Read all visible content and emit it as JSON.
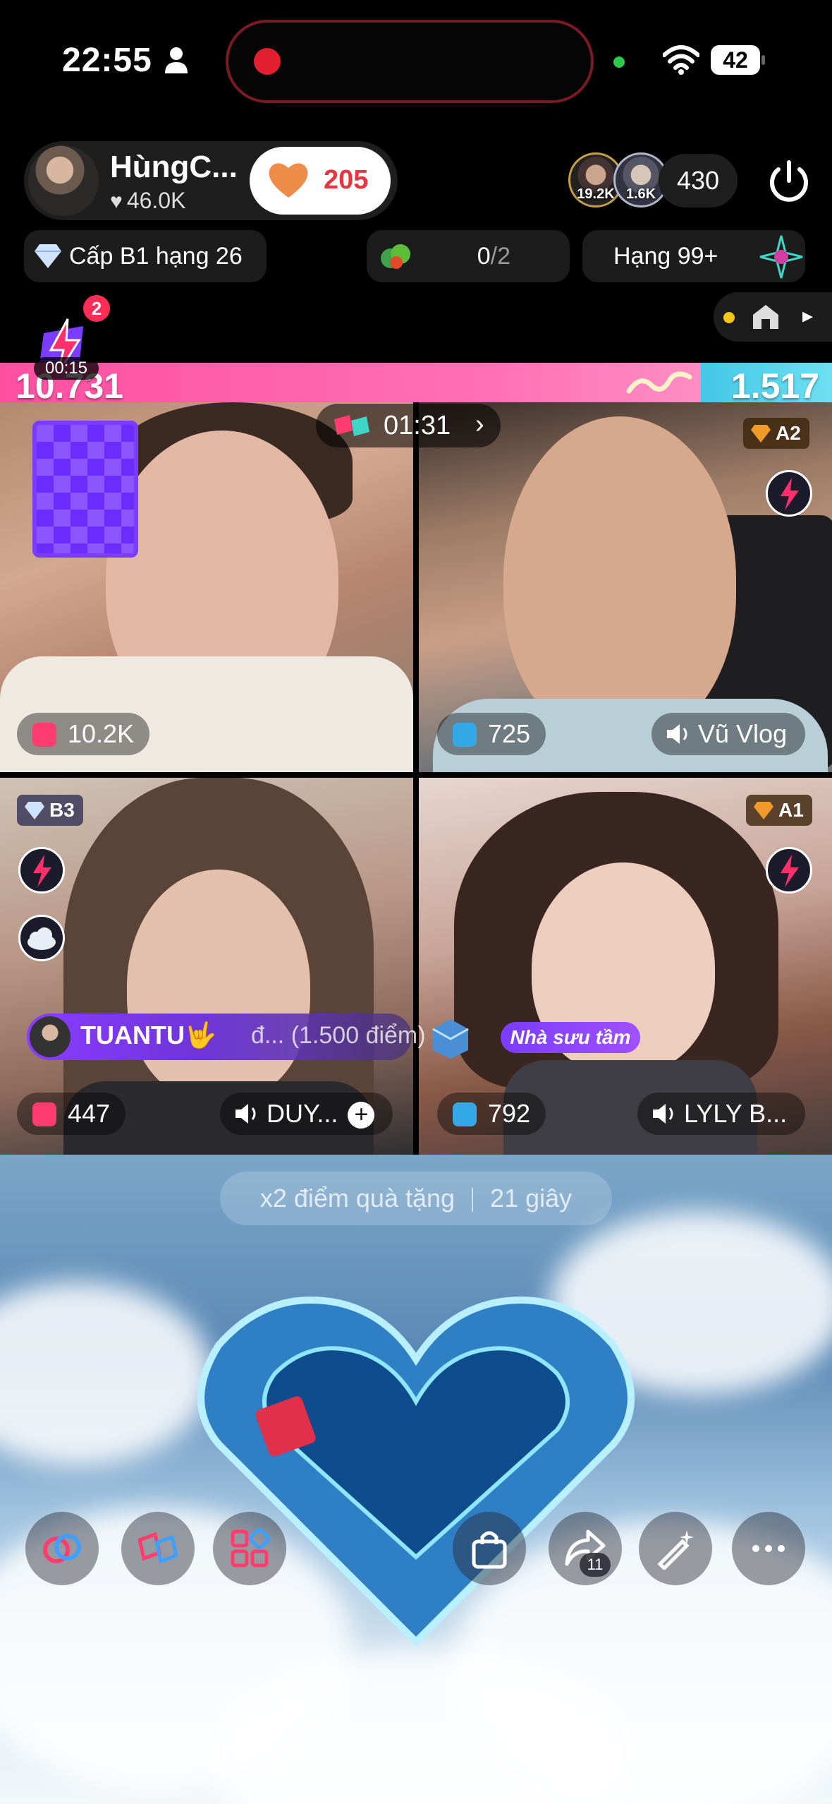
{
  "status_bar": {
    "time": "22:55",
    "battery": "42"
  },
  "host": {
    "name": "HùngC...",
    "likes": "46.0K",
    "follow_count": "205"
  },
  "viewers": {
    "avatar1_count": "19.2K",
    "avatar2_count": "1.6K",
    "total": "430"
  },
  "badges": {
    "level": "Cấp B1 hạng 26",
    "goal_num": "0",
    "goal_den": "/2",
    "rank": "Hạng 99+"
  },
  "gift": {
    "badge_count": "2",
    "timer": "00:15"
  },
  "battle": {
    "score_left": "10.731",
    "score_right": "1.517",
    "timer": "01:31"
  },
  "tiles": [
    {
      "score": "10.2K",
      "level": "",
      "name": ""
    },
    {
      "score": "725",
      "level": "A2",
      "name": "Vũ Vlog"
    },
    {
      "score": "447",
      "level": "B3",
      "name": "DUY..."
    },
    {
      "score": "792",
      "level": "A1",
      "name": "LYLY B..."
    }
  ],
  "gifter": {
    "name": "TUANTU🤟",
    "rest": "đ... (1.500 điểm)"
  },
  "collector_label": "Nhà sưu tầm",
  "bonus": {
    "text": "x2 điểm quà tặng",
    "time": "21 giây"
  },
  "share_count": "11",
  "colors": {
    "accent_pink": "#ff4fa3",
    "accent_blue": "#43c7e6",
    "follow_red": "#e8343c",
    "purple": "#7a3cff"
  }
}
